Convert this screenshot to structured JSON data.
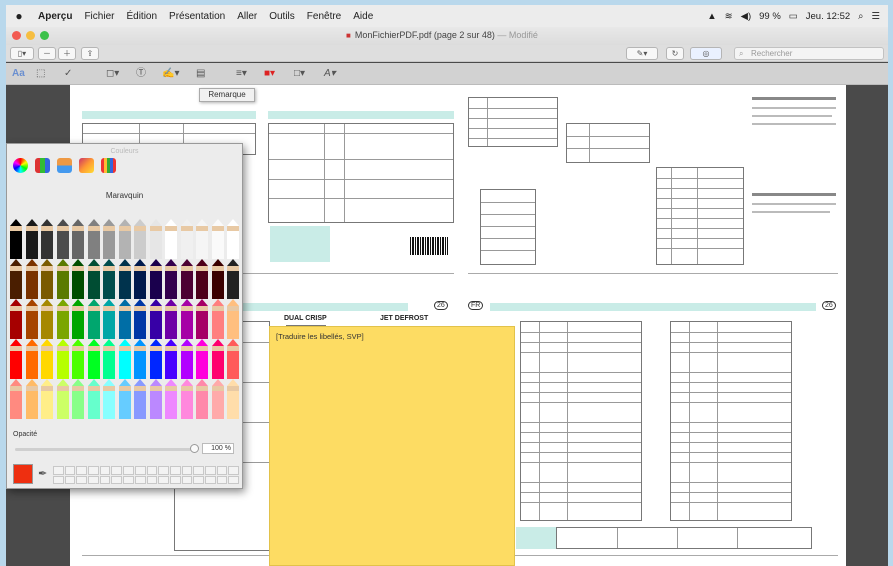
{
  "menubar": {
    "app_name": "Aperçu",
    "items": [
      "Fichier",
      "Édition",
      "Présentation",
      "Aller",
      "Outils",
      "Fenêtre",
      "Aide"
    ],
    "battery": "99 %",
    "clock": "Jeu. 12:52"
  },
  "window": {
    "title": "MonFichierPDF.pdf (page 2 sur 48)",
    "modified": "— Modifié"
  },
  "toolbar": {
    "search_placeholder": "Rechercher"
  },
  "tooltip": "Remarque",
  "sticky_note": {
    "text": "[Traduire les libellés, SVP]"
  },
  "colors_panel": {
    "title": "Couleurs",
    "palette_name": "Maravquin",
    "opacity_label": "Opacité",
    "opacity_value": "100 %",
    "opacity": 1.0,
    "selected_color": "#ee2f10"
  },
  "document": {
    "page_badge_left": "26",
    "page_badge_right": "26",
    "section_left": "FR",
    "dual_crisp": "DUAL CRISP",
    "jet_defrost": "JET DEFROST"
  },
  "colors": {
    "background": "#b9d8ec",
    "sticky": "#fddc63",
    "mint": "#c9ece7",
    "pdf_icon": "#cc3333"
  }
}
